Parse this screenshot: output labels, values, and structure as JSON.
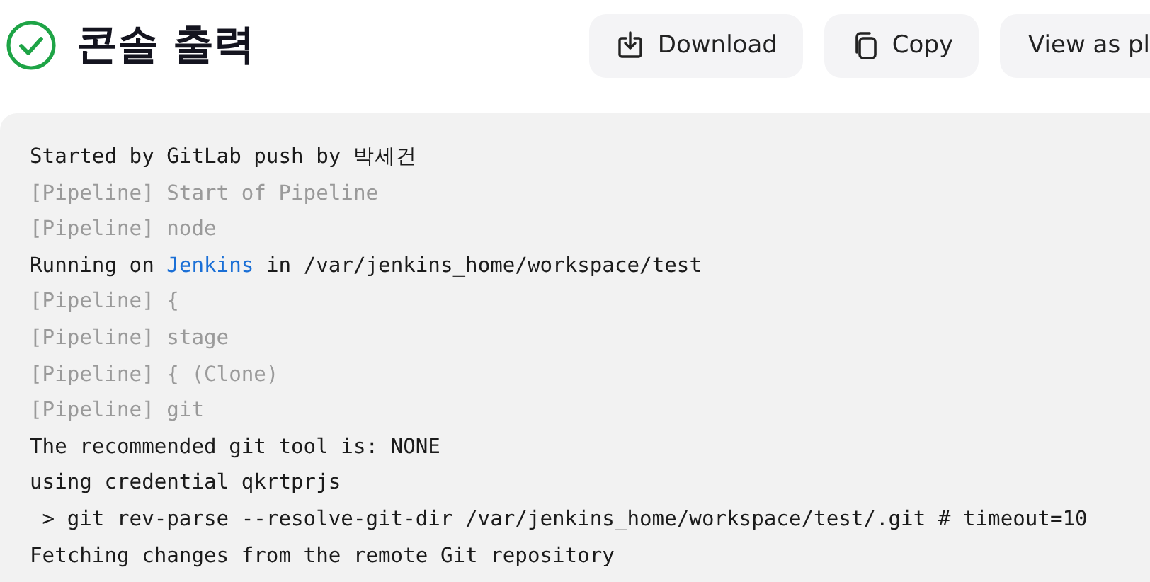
{
  "header": {
    "succeeded": true,
    "title": "콘솔 출력",
    "buttons": [
      {
        "kind": "download",
        "label": "Download"
      },
      {
        "kind": "copy",
        "label": "Copy"
      },
      {
        "kind": "view",
        "label": "View as pl"
      }
    ]
  },
  "console": {
    "lines": [
      {
        "kind": "plain",
        "text": "Started by GitLab push by 박세건"
      },
      {
        "kind": "pipeline",
        "text": "[Pipeline] Start of Pipeline"
      },
      {
        "kind": "pipeline",
        "text": "[Pipeline] node"
      },
      {
        "kind": "link",
        "before": "Running on ",
        "link": "Jenkins",
        "after": " in /var/jenkins_home/workspace/test"
      },
      {
        "kind": "pipeline",
        "text": "[Pipeline] {"
      },
      {
        "kind": "pipeline",
        "text": "[Pipeline] stage"
      },
      {
        "kind": "pipeline",
        "text": "[Pipeline] { (Clone)"
      },
      {
        "kind": "pipeline",
        "text": "[Pipeline] git"
      },
      {
        "kind": "plain",
        "text": "The recommended git tool is: NONE"
      },
      {
        "kind": "plain",
        "text": "using credential qkrtprjs"
      },
      {
        "kind": "plain",
        "text": " > git rev-parse --resolve-git-dir /var/jenkins_home/workspace/test/.git # timeout=10"
      },
      {
        "kind": "plain",
        "text": "Fetching changes from the remote Git repository"
      }
    ]
  }
}
